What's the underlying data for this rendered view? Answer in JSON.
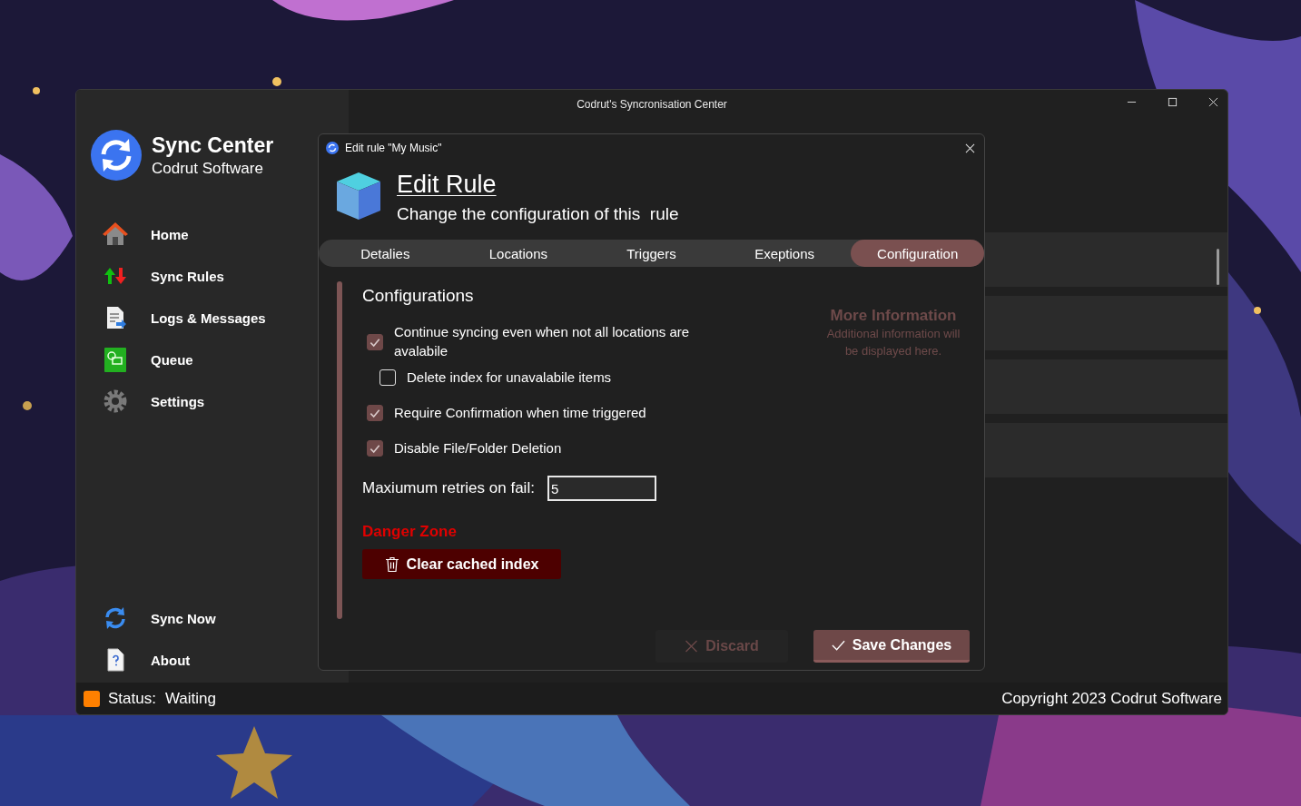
{
  "window": {
    "title": "Codrut's Syncronisation Center"
  },
  "sidebar": {
    "app_name": "Sync Center",
    "company": "Codrut Software",
    "items": [
      {
        "label": "Home",
        "kind": "home"
      },
      {
        "label": "Sync Rules",
        "kind": "rules"
      },
      {
        "label": "Logs & Messages",
        "kind": "logs"
      },
      {
        "label": "Queue",
        "kind": "queue"
      },
      {
        "label": "Settings",
        "kind": "settings"
      }
    ],
    "bottom_items": [
      {
        "label": "Sync Now",
        "kind": "sync"
      },
      {
        "label": "About",
        "kind": "about"
      }
    ]
  },
  "status_bar": {
    "label": "Status:",
    "value": "Waiting",
    "color": "#ff8000",
    "copyright": "Copyright 2023 Codrut Software"
  },
  "dialog": {
    "title": "Edit rule \"My Music\"",
    "heading": "Edit Rule",
    "subtitle": "Change the configuration of this  rule",
    "tabs": [
      {
        "label": "Detalies",
        "selected": false
      },
      {
        "label": "Locations",
        "selected": false
      },
      {
        "label": "Triggers",
        "selected": false
      },
      {
        "label": "Exeptions",
        "selected": false
      },
      {
        "label": "Configuration",
        "selected": true
      }
    ],
    "section_title": "Configurations",
    "options": [
      {
        "label": "Continue syncing even when not all locations are avalabile",
        "checked": true,
        "children": [
          {
            "label": "Delete index for unavalabile items",
            "checked": false
          }
        ]
      },
      {
        "label": "Require Confirmation when time triggered",
        "checked": true
      },
      {
        "label": "Disable File/Folder Deletion",
        "checked": true
      }
    ],
    "retries": {
      "label": "Maxiumum retries on fail:",
      "value": "5"
    },
    "danger_zone": {
      "title": "Danger Zone",
      "button": "Clear cached index"
    },
    "info": {
      "title": "More Information",
      "text": "Additional information will be displayed here."
    },
    "buttons": [
      {
        "label": "Discard",
        "kind": "discard",
        "disabled": true
      },
      {
        "label": "Save Changes",
        "kind": "save",
        "disabled": false
      }
    ]
  }
}
